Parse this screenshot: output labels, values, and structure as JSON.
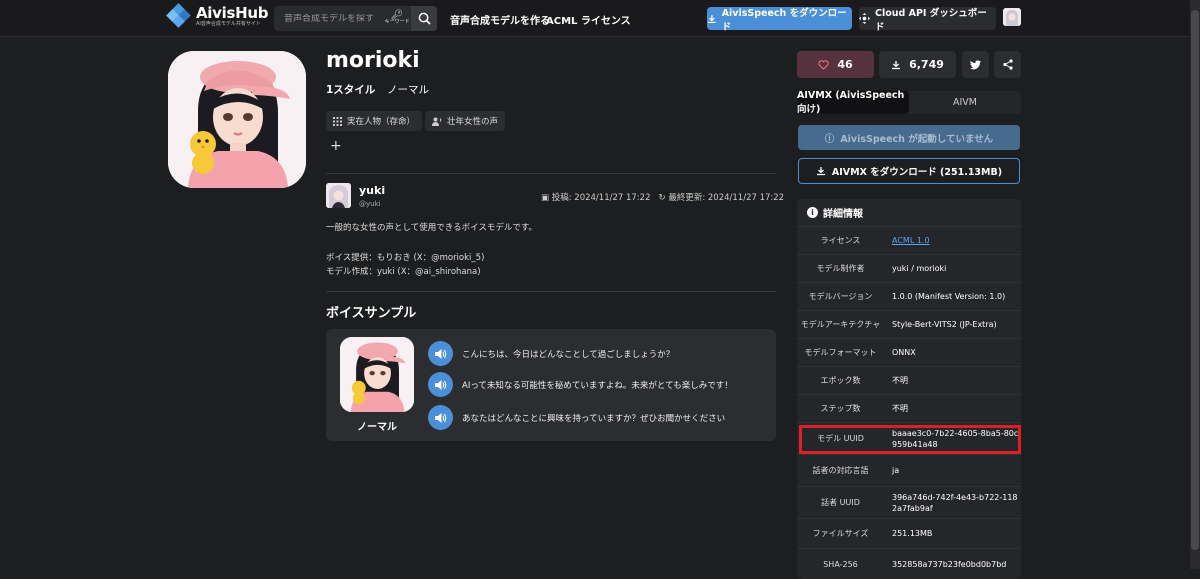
{
  "header": {
    "logo_title": "AivisHub",
    "logo_sub": "AI音声合成モデル共有サイト",
    "search_placeholder": "音声合成モデルを探す",
    "keyword_label": "キーワード",
    "nav": [
      "音声合成モデルを作る",
      "ACML ライセンス"
    ],
    "download_btn": "AivisSpeech をダウンロード",
    "cloud_btn": "Cloud API ダッシュボード"
  },
  "model": {
    "title": "morioki",
    "style_count": "1スタイル",
    "style_name": "ノーマル",
    "tags": [
      "実在人物（存命）",
      "壮年女性の声"
    ],
    "add_tag": "+"
  },
  "author": {
    "name": "yuki",
    "handle": "@yuki",
    "posted": "投稿: 2024/11/27 17:22",
    "updated": "最終更新: 2024/11/27 17:22"
  },
  "description": {
    "line1": "一般的な女性の声として使用できるボイスモデルです。",
    "line2": "ボイス提供：もりおき (X：@morioki_5)",
    "line3": "モデル作成：yuki (X：@ai_shirohana)"
  },
  "samples": {
    "title": "ボイスサンプル",
    "style": "ノーマル",
    "lines": [
      "こんにちは、今日はどんなことして過ごしましょうか？",
      "AIって未知なる可能性を秘めていますよね。未来がとても楽しみです！",
      "あなたはどんなことに興味を持っていますか？ぜひお聞かせください"
    ]
  },
  "sidebar": {
    "likes": "46",
    "downloads": "6,749",
    "tabs": [
      "AIVMX (AivisSpeech 向け)",
      "AIVM"
    ],
    "status_btn": "AivisSpeech が起動していません",
    "aivmx_btn": "AIVMX をダウンロード (251.13MB)",
    "details_title": "詳細情報",
    "details": [
      {
        "key": "ライセンス",
        "value": "ACML 1.0"
      },
      {
        "key": "モデル制作者",
        "value": "yuki / morioki"
      },
      {
        "key": "モデルバージョン",
        "value": "1.0.0 (Manifest Version: 1.0)"
      },
      {
        "key": "モデルアーキテクチャ",
        "value": "Style-Bert-VITS2 (JP-Extra)"
      },
      {
        "key": "モデルフォーマット",
        "value": "ONNX"
      },
      {
        "key": "エポック数",
        "value": "不明"
      },
      {
        "key": "ステップ数",
        "value": "不明"
      },
      {
        "key": "モデル UUID",
        "value": "baaae3c0-7b22-4605-8ba5-80c959b41a48"
      },
      {
        "key": "話者の対応言語",
        "value": "ja"
      },
      {
        "key": "話者 UUID",
        "value": "396a746d-742f-4e43-b722-1182a7fab9af"
      },
      {
        "key": "ファイルサイズ",
        "value": "251.13MB"
      },
      {
        "key": "SHA-256",
        "value": "352858a737b23fe0bd0b7bd"
      }
    ]
  },
  "colors": {
    "accent": "#4a8fd8",
    "highlight": "#dd1f26",
    "like_bg": "#55323d"
  }
}
